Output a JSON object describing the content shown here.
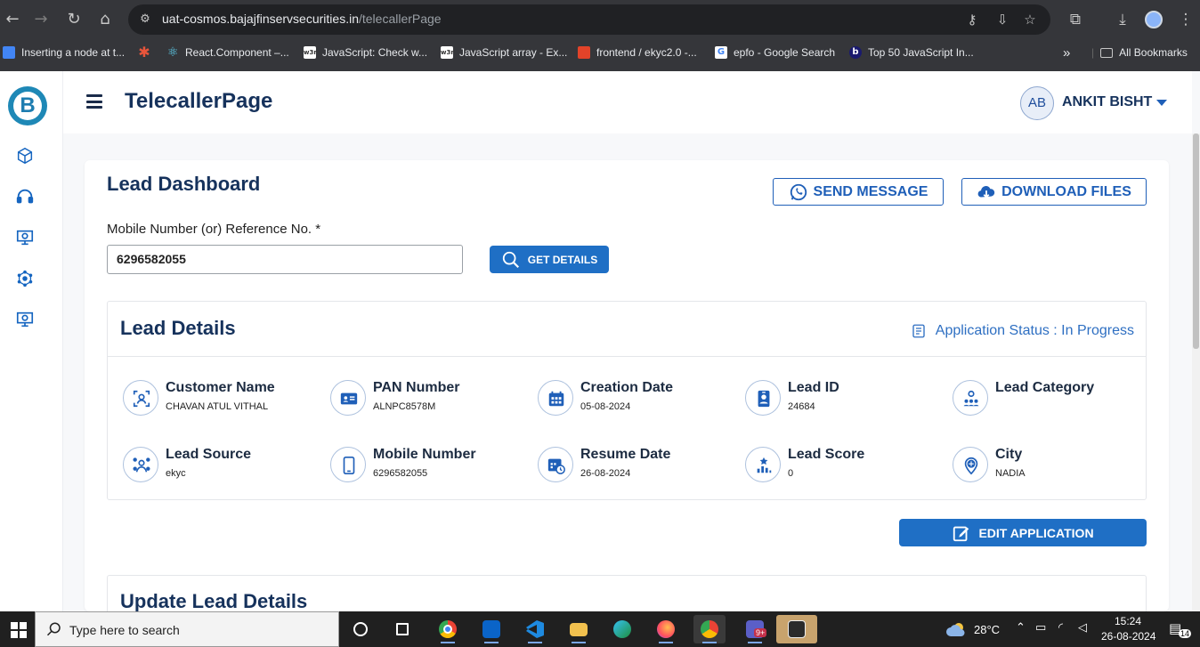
{
  "browser": {
    "url_host": "uat-cosmos.bajajfinservsecurities.in",
    "url_path": "/telecallerPage",
    "bookmarks": [
      {
        "label": "Inserting a node at t...",
        "icon": "bookmark-icon",
        "color": "#4285f4"
      },
      {
        "label": "",
        "icon": "asterisk-icon",
        "color": "#e8553b"
      },
      {
        "label": "React.Component –...",
        "icon": "react-icon",
        "color": "#61dafb"
      },
      {
        "label": "JavaScript: Check w...",
        "icon": "w3r-icon",
        "color": "#ffffff"
      },
      {
        "label": "JavaScript array - Ex...",
        "icon": "w3r-icon",
        "color": "#ffffff"
      },
      {
        "label": "frontend / ekyc2.0 -...",
        "icon": "gitlab-icon",
        "color": "#e24329"
      },
      {
        "label": "epfo - Google Search",
        "icon": "google-icon",
        "color": "#ffffff"
      },
      {
        "label": "Top 50 JavaScript In...",
        "icon": "b-icon",
        "color": "#1a1a6e"
      }
    ],
    "all_bookmarks": "All Bookmarks"
  },
  "header": {
    "title": "TelecallerPage",
    "avatar_initials": "AB",
    "user_name": "ANKIT BISHT"
  },
  "dashboard": {
    "title": "Lead Dashboard",
    "send_message": "SEND MESSAGE",
    "download_files": "DOWNLOAD FILES",
    "field_label": "Mobile Number (or) Reference No. *",
    "field_value": "6296582055",
    "get_details": "GET DETAILS"
  },
  "lead_details": {
    "title": "Lead Details",
    "status": "Application Status : In Progress",
    "items": [
      {
        "label": "Customer Name",
        "value": "CHAVAN ATUL VITHAL",
        "icon": "customer-icon"
      },
      {
        "label": "PAN Number",
        "value": "ALNPC8578M",
        "icon": "id-card-icon"
      },
      {
        "label": "Creation Date",
        "value": "05-08-2024",
        "icon": "calendar-icon"
      },
      {
        "label": "Lead ID",
        "value": "24684",
        "icon": "badge-icon"
      },
      {
        "label": "Lead Category",
        "value": "",
        "icon": "group-icon"
      },
      {
        "label": "Lead Source",
        "value": "ekyc",
        "icon": "source-icon"
      },
      {
        "label": "Mobile Number",
        "value": "6296582055",
        "icon": "mobile-icon"
      },
      {
        "label": "Resume Date",
        "value": "26-08-2024",
        "icon": "calendar-clock-icon"
      },
      {
        "label": "Lead Score",
        "value": "0",
        "icon": "score-icon"
      },
      {
        "label": "City",
        "value": "NADIA",
        "icon": "location-icon"
      }
    ],
    "edit_application": "EDIT APPLICATION"
  },
  "update_lead": {
    "title": "Update Lead Details"
  },
  "taskbar": {
    "search_placeholder": "Type here to search",
    "temperature": "28°C",
    "time": "15:24",
    "date": "26-08-2024",
    "notification_count": "14",
    "teams_badge": "9+"
  },
  "colors": {
    "primary": "#1f6fc5",
    "heading": "#16325c",
    "link": "#2e6fc2"
  }
}
